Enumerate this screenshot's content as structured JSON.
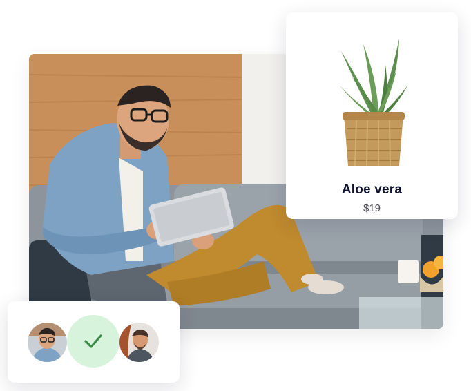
{
  "product": {
    "name": "Aloe vera",
    "price": "$19"
  },
  "icons": {
    "confirm": "check-icon"
  },
  "colors": {
    "check_bg": "#d8f3dc",
    "check_stroke": "#3a8a4a",
    "title": "#101330"
  }
}
